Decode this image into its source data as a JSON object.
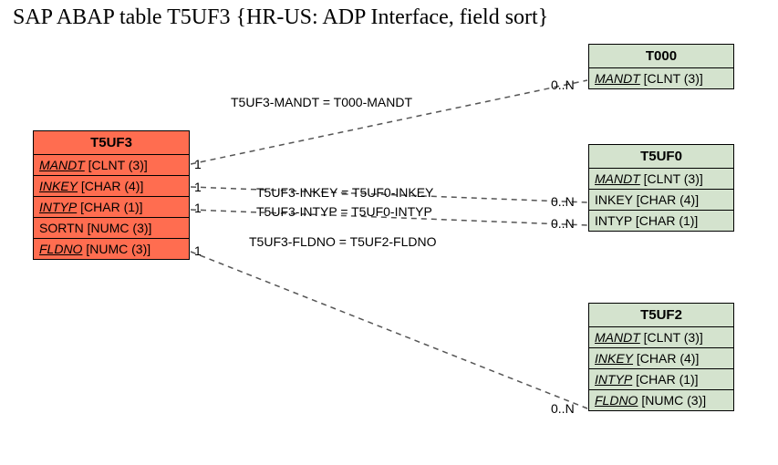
{
  "title": "SAP ABAP table T5UF3 {HR-US: ADP Interface, field sort}",
  "left_table": {
    "name": "T5UF3",
    "fields": [
      {
        "name": "MANDT",
        "type": "[CLNT (3)]",
        "fk": true
      },
      {
        "name": "INKEY",
        "type": "[CHAR (4)]",
        "fk": true
      },
      {
        "name": "INTYP",
        "type": "[CHAR (1)]",
        "fk": true
      },
      {
        "name": "SORTN",
        "type": "[NUMC (3)]",
        "fk": false
      },
      {
        "name": "FLDNO",
        "type": "[NUMC (3)]",
        "fk": true
      }
    ]
  },
  "right_tables": [
    {
      "name": "T000",
      "fields": [
        {
          "name": "MANDT",
          "type": "[CLNT (3)]",
          "fk": true
        }
      ]
    },
    {
      "name": "T5UF0",
      "fields": [
        {
          "name": "MANDT",
          "type": "[CLNT (3)]",
          "fk": true
        },
        {
          "name": "INKEY",
          "type": "[CHAR (4)]",
          "fk": false
        },
        {
          "name": "INTYP",
          "type": "[CHAR (1)]",
          "fk": false
        }
      ]
    },
    {
      "name": "T5UF2",
      "fields": [
        {
          "name": "MANDT",
          "type": "[CLNT (3)]",
          "fk": true
        },
        {
          "name": "INKEY",
          "type": "[CHAR (4)]",
          "fk": true
        },
        {
          "name": "INTYP",
          "type": "[CHAR (1)]",
          "fk": true
        },
        {
          "name": "FLDNO",
          "type": "[NUMC (3)]",
          "fk": true
        }
      ]
    }
  ],
  "relations": [
    {
      "label": "T5UF3-MANDT = T000-MANDT",
      "left_card": "",
      "right_card": "0..N"
    },
    {
      "label": "T5UF3-INKEY = T5UF0-INKEY",
      "left_card": "1",
      "right_card": "0..N"
    },
    {
      "label": "T5UF3-INTYP = T5UF0-INTYP",
      "left_card": "1",
      "right_card": "0..N"
    },
    {
      "label": "T5UF3-FLDNO = T5UF2-FLDNO",
      "left_card": "1",
      "right_card": ""
    }
  ],
  "extra_cards": {
    "lc_mandt": "1",
    "rc_fldno": "0..N"
  }
}
